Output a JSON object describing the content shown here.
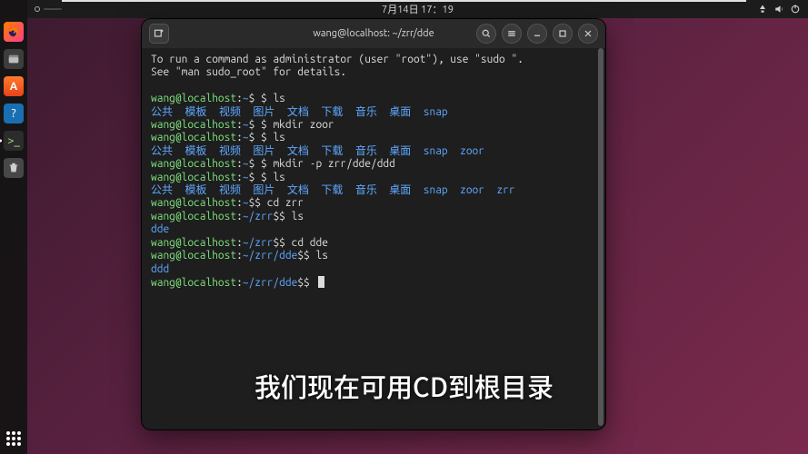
{
  "panel": {
    "datetime": "7月14日  17：19"
  },
  "dock": {
    "apps_tooltip": "Show Applications"
  },
  "terminal": {
    "title": "wang@localhost: ~/zrr/dde",
    "user": "wang",
    "host": "localhost",
    "sudo_hint_l1": "To run a command as administrator (user \"root\"), use \"sudo <command>\".",
    "sudo_hint_l2": "See \"man sudo_root\" for details.",
    "cmds": {
      "ls": "ls",
      "mkdir_zoor": "mkdir zoor",
      "mkdir_p": "mkdir -p zrr/dde/ddd",
      "cd_zrr": "cd zrr",
      "cd_dde": "cd dde"
    },
    "paths": {
      "home": "~",
      "zrr": "~/zrr",
      "dde": "~/zrr/dde"
    },
    "dirs_base": [
      "公共",
      "模板",
      "视频",
      "图片",
      "文档",
      "下载",
      "音乐",
      "桌面",
      "snap"
    ],
    "dirs_zoor": [
      "公共",
      "模板",
      "视频",
      "图片",
      "文档",
      "下载",
      "音乐",
      "桌面",
      "snap",
      "zoor"
    ],
    "dirs_zrr": [
      "公共",
      "模板",
      "视频",
      "图片",
      "文档",
      "下载",
      "音乐",
      "桌面",
      "snap",
      "zoor",
      "zrr"
    ],
    "ls_zrr_out": "dde",
    "ls_dde_out": "ddd"
  },
  "subtitle": "我们现在可用CD到根目录"
}
